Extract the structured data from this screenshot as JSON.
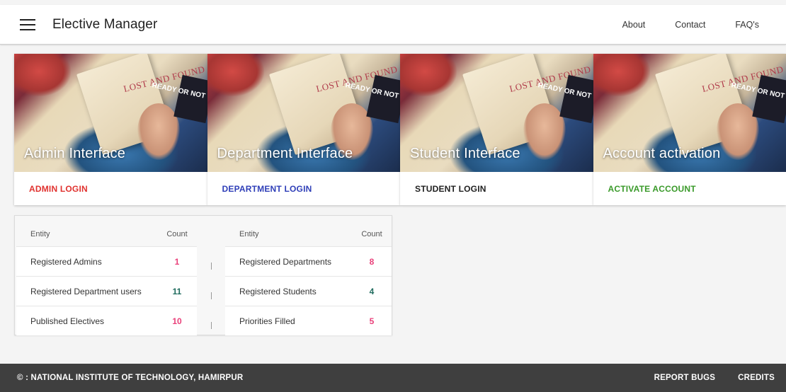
{
  "header": {
    "title": "Elective Manager",
    "nav": [
      "About",
      "Contact",
      "FAQ's"
    ]
  },
  "cards": [
    {
      "title": "Admin Interface",
      "action": "ADMIN LOGIN",
      "action_color": "#e0322f"
    },
    {
      "title": "Department Interface",
      "action": "DEPARTMENT LOGIN",
      "action_color": "#2f3fb8"
    },
    {
      "title": "Student Interface",
      "action": "STUDENT LOGIN",
      "action_color": "#1f1f1f"
    },
    {
      "title": "Account activation",
      "action": "ACTIVATE ACCOUNT",
      "action_color": "#3a9a2a"
    }
  ],
  "card_image_text": {
    "book": "LOST AND FOUND",
    "corner": "READY OR NOT"
  },
  "stats": {
    "header_entity": "Entity",
    "header_count": "Count",
    "left": [
      {
        "entity": "Registered Admins",
        "count": "1",
        "color": "#e9407a"
      },
      {
        "entity": "Registered Department users",
        "count": "11",
        "color": "#1f6b5e"
      },
      {
        "entity": "Published Electives",
        "count": "10",
        "color": "#e9407a"
      }
    ],
    "right": [
      {
        "entity": "Registered Departments",
        "count": "8",
        "color": "#e9407a"
      },
      {
        "entity": "Registered Students",
        "count": "4",
        "color": "#1f6b5e"
      },
      {
        "entity": "Priorities Filled",
        "count": "5",
        "color": "#e9407a"
      }
    ]
  },
  "footer": {
    "copyright": "© : NATIONAL INSTITUTE OF TECHNOLOGY, HAMIRPUR",
    "links": [
      "REPORT BUGS",
      "CREDITS"
    ]
  }
}
